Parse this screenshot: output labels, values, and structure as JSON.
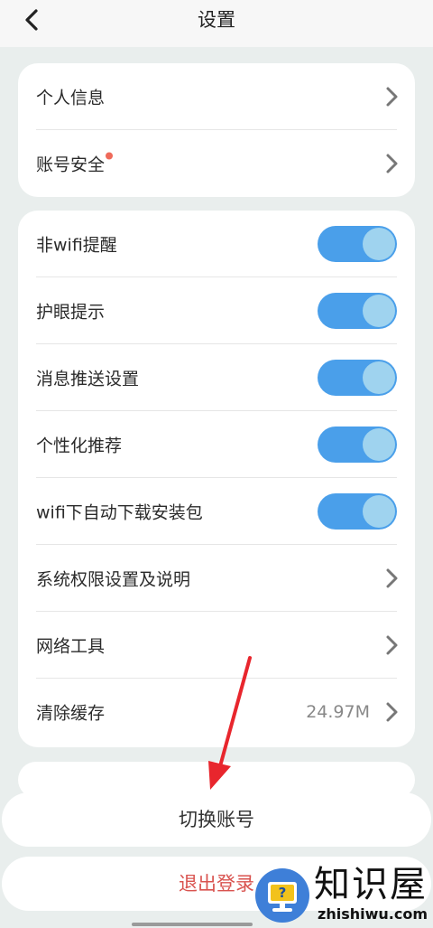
{
  "header": {
    "title": "设置"
  },
  "account_section": {
    "items": [
      {
        "label": "个人信息",
        "icon": "chevron-right-icon"
      },
      {
        "label": "账号安全",
        "icon": "chevron-right-icon",
        "badge": "red-dot"
      }
    ]
  },
  "settings_section": {
    "items": [
      {
        "label": "非wifi提醒",
        "toggle": true
      },
      {
        "label": "护眼提示",
        "toggle": true
      },
      {
        "label": "消息推送设置",
        "toggle": true
      },
      {
        "label": "个性化推荐",
        "toggle": true
      },
      {
        "label": "wifi下自动下载安装包",
        "toggle": true
      },
      {
        "label": "系统权限设置及说明",
        "icon": "chevron-right-icon"
      },
      {
        "label": "网络工具",
        "icon": "chevron-right-icon"
      },
      {
        "label": "清除缓存",
        "value": "24.97M",
        "icon": "chevron-right-icon"
      }
    ]
  },
  "actions": {
    "switch_account": "切换账号",
    "logout": "退出登录"
  },
  "watermark": {
    "name": "知识屋",
    "domain": "zhishiwu.com"
  },
  "colors": {
    "background": "#e9eeed",
    "toggle_on": "#4a9fea",
    "logout_text": "#d9534f",
    "badge_dot": "#ef6a5a",
    "annotation_arrow": "#e8262d"
  }
}
